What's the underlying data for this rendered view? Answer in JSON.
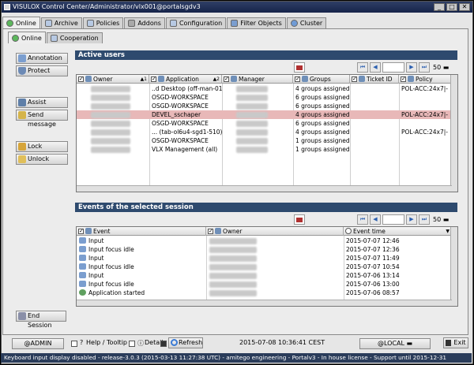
{
  "window": {
    "title": "VISULOX Control Center/Administrator/vlx001@portalsgdv3",
    "buttons": [
      "_",
      "□",
      "✕"
    ]
  },
  "main_tabs": [
    {
      "label": "Online",
      "icon": "online-icon"
    },
    {
      "label": "Archive",
      "icon": "archive-icon"
    },
    {
      "label": "Policies",
      "icon": "policies-icon"
    },
    {
      "label": "Addons",
      "icon": "addons-icon"
    },
    {
      "label": "Configuration",
      "icon": "configuration-icon"
    },
    {
      "label": "Filter Objects",
      "icon": "filter-objects-icon"
    },
    {
      "label": "Cluster",
      "icon": "cluster-icon"
    }
  ],
  "sub_tabs": [
    {
      "label": "Online",
      "icon": "online-icon"
    },
    {
      "label": "Cooperation",
      "icon": "cooperation-icon"
    }
  ],
  "side_buttons": {
    "annotation": "Annotation",
    "protect": "Protect",
    "assist": "Assist",
    "send_message": "Send message",
    "lock": "Lock",
    "unlock": "Unlock",
    "end_session": "End Session"
  },
  "active_users": {
    "title": "Active users",
    "page_size": "50",
    "columns": [
      "Owner",
      "Application",
      "Manager",
      "Groups",
      "Ticket ID",
      "Policy"
    ],
    "sort_markers": [
      "▲1",
      "▲2"
    ],
    "rows": [
      {
        "owner": "",
        "application": "..d Desktop (off-man-01)",
        "manager": "",
        "groups": "4 groups assigned",
        "ticket": "",
        "policy": "POL-ACC:24x7|-",
        "selected": false
      },
      {
        "owner": "",
        "application": "OSGD-WORKSPACE",
        "manager": "",
        "groups": "6 groups assigned",
        "ticket": "",
        "policy": "",
        "selected": false
      },
      {
        "owner": "",
        "application": "OSGD-WORKSPACE",
        "manager": "",
        "groups": "6 groups assigned",
        "ticket": "",
        "policy": "",
        "selected": false
      },
      {
        "owner": "",
        "application": "DEVEL_sschaper",
        "manager": "",
        "groups": "4 groups assigned",
        "ticket": "",
        "policy": "POL-ACC:24x7|-",
        "selected": true
      },
      {
        "owner": "",
        "application": "OSGD-WORKSPACE",
        "manager": "",
        "groups": "6 groups assigned",
        "ticket": "",
        "policy": "",
        "selected": false
      },
      {
        "owner": "",
        "application": "... (tab-ol6u4-sgd1-510)",
        "manager": "",
        "groups": "4 groups assigned",
        "ticket": "",
        "policy": "POL-ACC:24x7|-",
        "selected": false
      },
      {
        "owner": "",
        "application": "OSGD-WORKSPACE",
        "manager": "",
        "groups": "1 groups assigned",
        "ticket": "",
        "policy": "",
        "selected": false
      },
      {
        "owner": "",
        "application": "VLX Management (all)",
        "manager": "",
        "groups": "1 groups assigned",
        "ticket": "",
        "policy": "",
        "selected": false
      }
    ]
  },
  "events": {
    "title": "Events of the selected session",
    "page_size": "50",
    "columns": [
      "Event",
      "Owner",
      "Event time"
    ],
    "rows": [
      {
        "event": "Input",
        "icon": "input-icon",
        "time": "2015-07-07 12:46"
      },
      {
        "event": "Input focus idle",
        "icon": "input-focus-idle-icon",
        "time": "2015-07-07 12:36"
      },
      {
        "event": "Input",
        "icon": "input-icon",
        "time": "2015-07-07 11:49"
      },
      {
        "event": "Input focus idle",
        "icon": "input-focus-idle-icon",
        "time": "2015-07-07 10:54"
      },
      {
        "event": "Input",
        "icon": "input-icon",
        "time": "2015-07-06 13:14"
      },
      {
        "event": "Input focus idle",
        "icon": "input-focus-idle-icon",
        "time": "2015-07-06 13:00"
      },
      {
        "event": "Application started",
        "icon": "application-started-icon",
        "time": "2015-07-06 08:57"
      }
    ]
  },
  "footer": {
    "admin_button": "@ADMIN",
    "help_tooltip": "Help / Tooltip",
    "details": "Details",
    "refresh": "Refresh",
    "datetime": "2015-07-08 10:36:41 CEST",
    "local_select": "@LOCAL",
    "exit": "Exit"
  },
  "status_bar": "Keyboard input display disabled - release-3.0.3 (2015-03-13 11:27:38 UTC) - amitego engineering - Portalv3 - In house license - Support until 2015-12-31"
}
